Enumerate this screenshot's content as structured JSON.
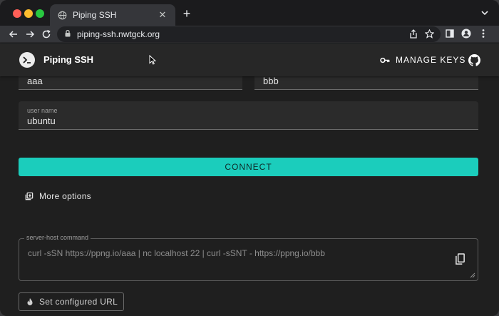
{
  "browser": {
    "tab_title": "Piping SSH",
    "url": "piping-ssh.nwtgck.org"
  },
  "app": {
    "title": "Piping SSH",
    "manage_keys_label": "MANAGE KEYS"
  },
  "form": {
    "server_inbox_value": "aaa",
    "server_outbox_value": "bbb",
    "user_name_label": "user name",
    "user_name_value": "ubuntu",
    "connect_label": "CONNECT",
    "more_options_label": "More options",
    "command_label": "server-host command",
    "command_value": "curl -sSN https://ppng.io/aaa | nc localhost 22 | curl -sSNT - https://ppng.io/bbb",
    "set_url_label": "Set configured URL"
  },
  "colors": {
    "accent": "#1bcdbc",
    "background": "#1f1f1f",
    "appbar": "#272727"
  },
  "icons": {
    "logo": "terminal-icon",
    "manage_keys": "key-icon",
    "repo": "github-icon",
    "more_options": "library-add-icon",
    "copy": "copy-icon",
    "set_url": "fire-icon"
  }
}
